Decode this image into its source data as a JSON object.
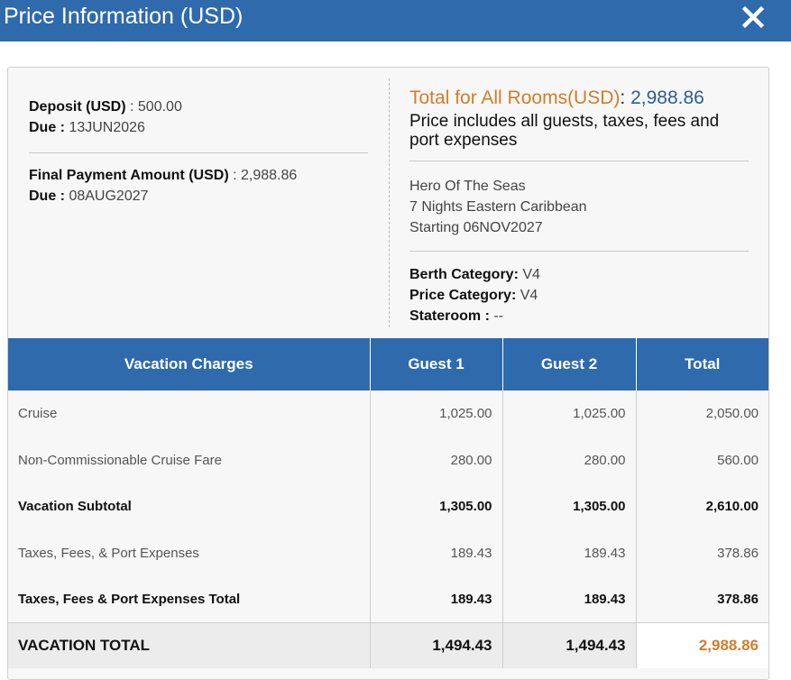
{
  "header": {
    "title": "Price Information (USD)",
    "close_icon": "close-icon"
  },
  "payment": {
    "deposit_label": "Deposit (USD)",
    "deposit_value": ": 500.00",
    "deposit_due_label": "Due :",
    "deposit_due_value": "13JUN2026",
    "final_label": "Final Payment Amount (USD)",
    "final_value": ": 2,988.86",
    "final_due_label": "Due :",
    "final_due_value": "08AUG2027"
  },
  "summary": {
    "total_label": "Total for All Rooms(USD)",
    "total_colon": ":",
    "total_value": "2,988.86",
    "includes_text": "Price includes all guests, taxes, fees and port expenses",
    "ship": "Hero Of The Seas",
    "itinerary": "7 Nights Eastern Caribbean",
    "starting": "Starting 06NOV2027",
    "berth_label": "Berth Category:",
    "berth_value": "V4",
    "price_cat_label": "Price Category:",
    "price_cat_value": "V4",
    "stateroom_label": "Stateroom :",
    "stateroom_value": "--"
  },
  "table": {
    "headers": [
      "Vacation Charges",
      "Guest 1",
      "Guest 2",
      "Total"
    ],
    "rows": [
      {
        "label": "Cruise",
        "g1": "1,025.00",
        "g2": "1,025.00",
        "total": "2,050.00"
      },
      {
        "label": "Non-Commissionable Cruise Fare",
        "g1": "280.00",
        "g2": "280.00",
        "total": "560.00"
      },
      {
        "label": "Vacation Subtotal",
        "g1": "1,305.00",
        "g2": "1,305.00",
        "total": "2,610.00"
      },
      {
        "label": "Taxes, Fees, & Port Expenses",
        "g1": "189.43",
        "g2": "189.43",
        "total": "378.86"
      },
      {
        "label": "Taxes, Fees & Port Expenses Total",
        "g1": "189.43",
        "g2": "189.43",
        "total": "378.86"
      }
    ],
    "grand": {
      "label": "VACATION TOTAL",
      "g1": "1,494.43",
      "g2": "1,494.43",
      "total": "2,988.86"
    }
  },
  "colors": {
    "header_blue": "#2f6aad",
    "accent_orange": "#d07d2b",
    "value_blue": "#2c5d93"
  }
}
